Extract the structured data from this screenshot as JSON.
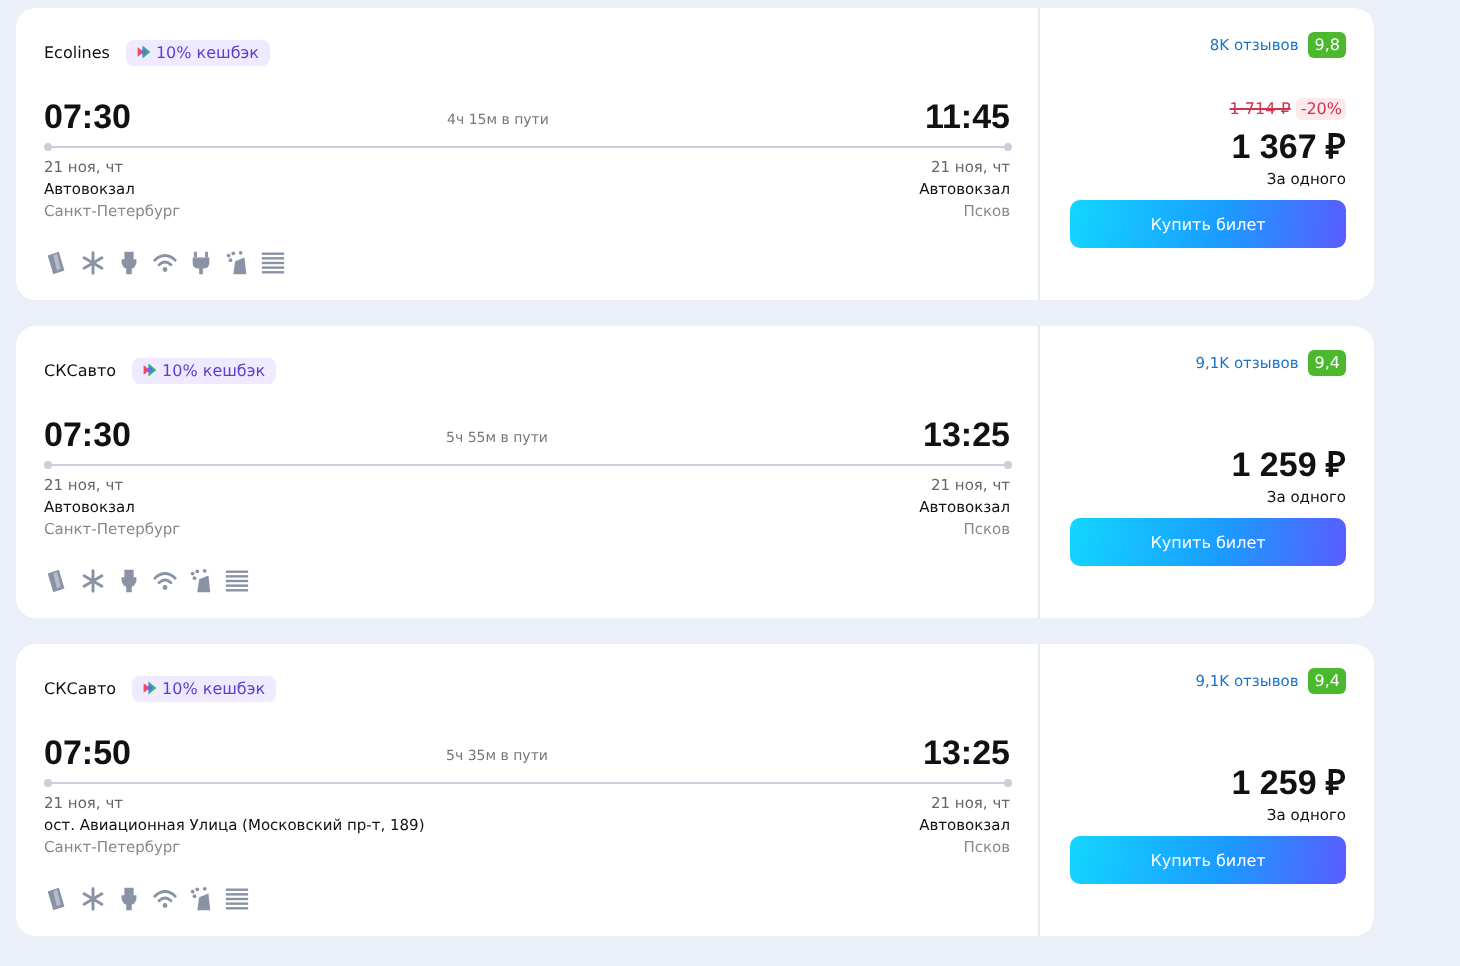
{
  "trips": [
    {
      "carrier": "Ecolines",
      "cashback": "10% кешбэк",
      "departure": {
        "time": "07:30",
        "date": "21 ноя, чт",
        "station": "Автовокзал",
        "city": "Санкт-Петербург"
      },
      "duration": "4ч 15м в пути",
      "arrival": {
        "time": "11:45",
        "date": "21 ноя, чт",
        "station": "Автовокзал",
        "city": "Псков"
      },
      "amenities": [
        {
          "kind": "ticket"
        },
        {
          "kind": "snow"
        },
        {
          "kind": "toilet"
        },
        {
          "kind": "wifi"
        },
        {
          "kind": "plug"
        },
        {
          "kind": "spray"
        },
        {
          "kind": "blinds"
        }
      ],
      "reviews": "8K отзывов",
      "rating": "9,8",
      "old_price": "1 714 ₽",
      "discount": "-20%",
      "price": "1 367 ₽",
      "price_note": "За одного",
      "button": "Купить билет"
    },
    {
      "carrier": "СКСавто",
      "cashback": "10% кешбэк",
      "departure": {
        "time": "07:30",
        "date": "21 ноя, чт",
        "station": "Автовокзал",
        "city": "Санкт-Петербург"
      },
      "duration": "5ч 55м в пути",
      "arrival": {
        "time": "13:25",
        "date": "21 ноя, чт",
        "station": "Автовокзал",
        "city": "Псков"
      },
      "amenities": [
        {
          "kind": "ticket"
        },
        {
          "kind": "snow"
        },
        {
          "kind": "toilet"
        },
        {
          "kind": "wifi"
        },
        {
          "kind": "spray"
        },
        {
          "kind": "blinds"
        }
      ],
      "reviews": "9,1K отзывов",
      "rating": "9,4",
      "price": "1 259 ₽",
      "price_note": "За одного",
      "button": "Купить билет"
    },
    {
      "carrier": "СКСавто",
      "cashback": "10% кешбэк",
      "departure": {
        "time": "07:50",
        "date": "21 ноя, чт",
        "station": "ост. Авиационная Улица (Московский пр-т, 189)",
        "city": "Санкт-Петербург"
      },
      "duration": "5ч 35м в пути",
      "arrival": {
        "time": "13:25",
        "date": "21 ноя, чт",
        "station": "Автовокзал",
        "city": "Псков"
      },
      "amenities": [
        {
          "kind": "ticket"
        },
        {
          "kind": "snow"
        },
        {
          "kind": "toilet"
        },
        {
          "kind": "wifi"
        },
        {
          "kind": "spray"
        },
        {
          "kind": "blinds"
        }
      ],
      "reviews": "9,1K отзывов",
      "rating": "9,4",
      "price": "1 259 ₽",
      "price_note": "За одного",
      "button": "Купить билет"
    }
  ]
}
